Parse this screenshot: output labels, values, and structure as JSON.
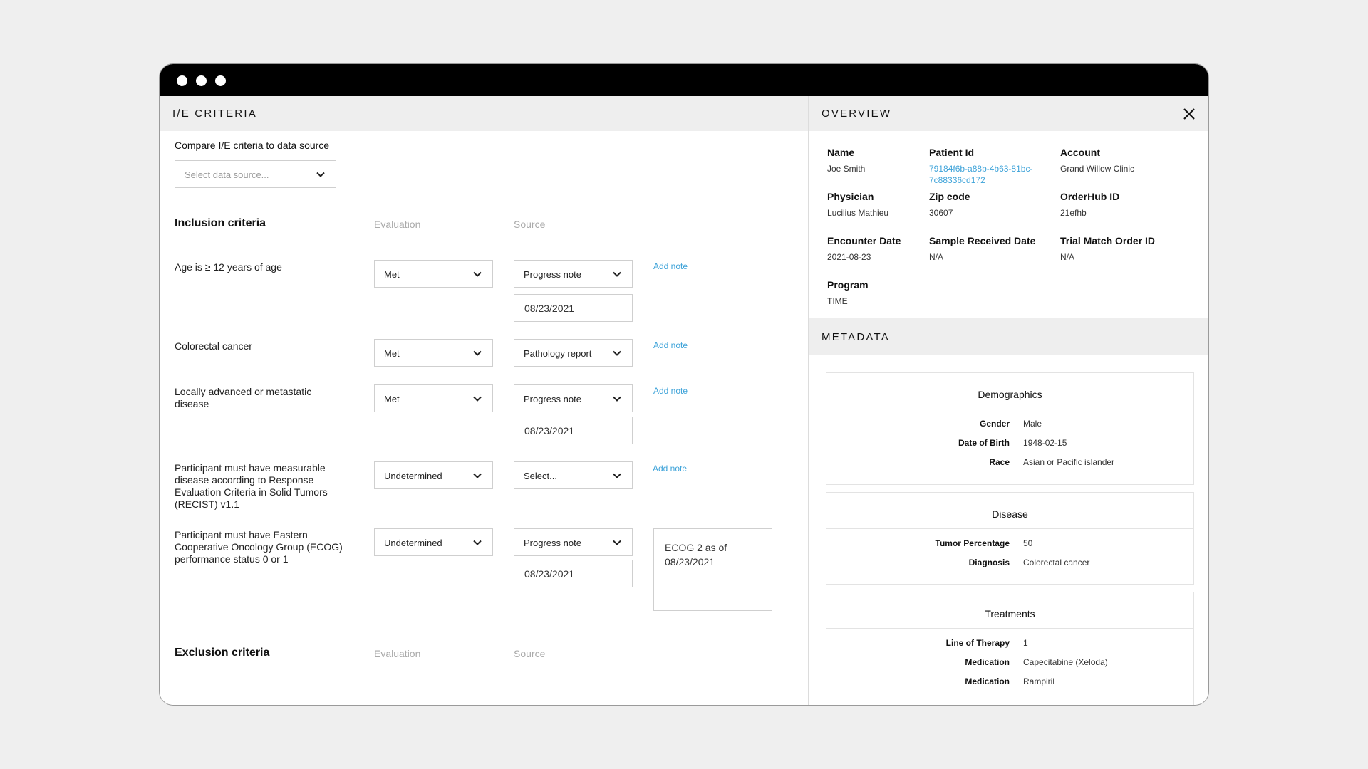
{
  "left_panel": {
    "title": "I/E CRITERIA",
    "compare_label": "Compare I/E criteria to data source",
    "data_source_placeholder": "Select data source...",
    "inclusion": {
      "title": "Inclusion criteria",
      "evaluation_header": "Evaluation",
      "source_header": "Source",
      "rows": [
        {
          "label": "Age is ≥ 12 years of age",
          "evaluation": "Met",
          "source": "Progress note",
          "date": "08/23/2021",
          "note_link": "Add note"
        },
        {
          "label": "Colorectal cancer",
          "evaluation": "Met",
          "source": "Pathology report",
          "note_link": "Add note"
        },
        {
          "label": "Locally advanced or metastatic disease",
          "evaluation": "Met",
          "source": "Progress note",
          "date": "08/23/2021",
          "note_link": "Add note"
        },
        {
          "label": "Participant must have measurable disease according to Response Evaluation Criteria in Solid Tumors (RECIST) v1.1",
          "evaluation": "Undetermined",
          "source": "Select...",
          "note_link": "Add note"
        },
        {
          "label": "Participant must have Eastern Cooperative Oncology Group (ECOG) performance status 0 or 1",
          "evaluation": "Undetermined",
          "source": "Progress note",
          "date": "08/23/2021",
          "note": "ECOG 2 as of 08/23/2021"
        }
      ]
    },
    "exclusion": {
      "title": "Exclusion criteria",
      "evaluation_header": "Evaluation",
      "source_header": "Source"
    }
  },
  "right_panel": {
    "overview_title": "OVERVIEW",
    "fields": {
      "name": {
        "label": "Name",
        "value": "Joe Smith"
      },
      "patient_id": {
        "label": "Patient Id",
        "value": "79184f6b-a88b-4b63-81bc-7c88336cd172"
      },
      "account": {
        "label": "Account",
        "value": "Grand Willow Clinic"
      },
      "physician": {
        "label": "Physician",
        "value": "Lucilius Mathieu"
      },
      "zip": {
        "label": "Zip code",
        "value": "30607"
      },
      "orderhub": {
        "label": "OrderHub ID",
        "value": "21efhb"
      },
      "encounter": {
        "label": "Encounter Date",
        "value": "2021-08-23"
      },
      "sample": {
        "label": "Sample Received Date",
        "value": "N/A"
      },
      "trial": {
        "label": "Trial Match Order ID",
        "value": "N/A"
      },
      "program": {
        "label": "Program",
        "value": "TIME"
      }
    },
    "metadata_title": "METADATA",
    "demographics": {
      "title": "Demographics",
      "rows": [
        {
          "key": "Gender",
          "value": "Male"
        },
        {
          "key": "Date of Birth",
          "value": "1948-02-15"
        },
        {
          "key": "Race",
          "value": "Asian or Pacific islander"
        }
      ]
    },
    "disease": {
      "title": "Disease",
      "rows": [
        {
          "key": "Tumor Percentage",
          "value": "50"
        },
        {
          "key": "Diagnosis",
          "value": "Colorectal cancer"
        }
      ]
    },
    "treatments": {
      "title": "Treatments",
      "rows": [
        {
          "key": "Line of Therapy",
          "value": "1"
        },
        {
          "key": "Medication",
          "value": "Capecitabine (Xeloda)"
        },
        {
          "key": "Medication",
          "value": "Rampiril"
        }
      ]
    }
  },
  "icons": {
    "chevron": "chevron-down-icon",
    "close": "close-icon"
  }
}
